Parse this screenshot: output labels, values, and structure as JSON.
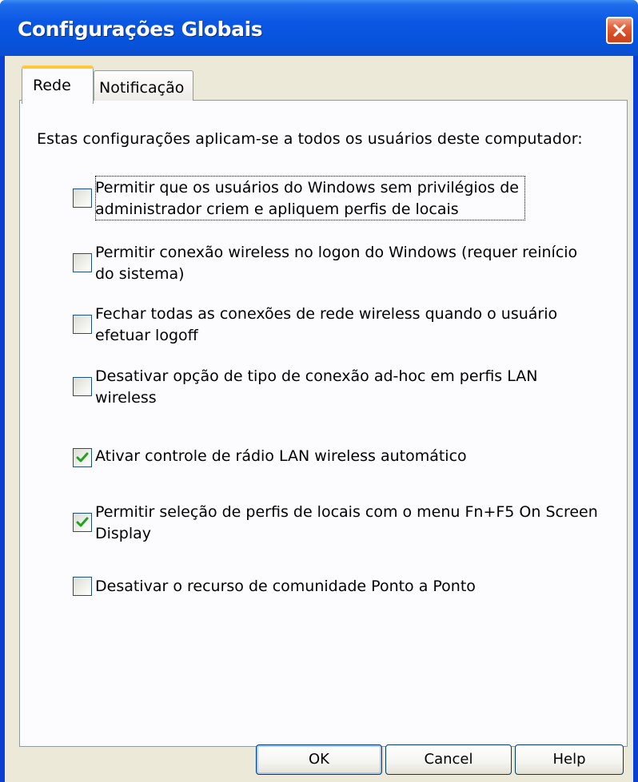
{
  "window": {
    "title": "Configurações Globais"
  },
  "tabs": [
    {
      "label": "Rede",
      "selected": true
    },
    {
      "label": "Notificação",
      "selected": false
    }
  ],
  "intro": "Estas configurações aplicam-se a todos os usuários deste computador:",
  "options": [
    {
      "label": "Permitir que os usuários do Windows sem privilégios de\nadministrador criem e apliquem perfis de locais",
      "checked": false
    },
    {
      "label": "Permitir conexão wireless no logon do Windows (requer reinício\ndo sistema)",
      "checked": false
    },
    {
      "label": "Fechar todas as conexões de rede wireless quando o usuário\nefetuar logoff",
      "checked": false
    },
    {
      "label": "Desativar opção de tipo de conexão ad-hoc em perfis LAN\nwireless",
      "checked": false
    },
    {
      "label": "Ativar controle de rádio LAN wireless automático",
      "checked": true
    },
    {
      "label": "Permitir seleção de perfis de locais com o menu Fn+F5 On Screen\nDisplay",
      "checked": true
    },
    {
      "label": "Desativar o recurso de comunidade Ponto a Ponto",
      "checked": false
    }
  ],
  "buttons": {
    "ok": "OK",
    "cancel": "Cancel",
    "help": "Help"
  },
  "colors": {
    "title_bar": "#0653dc",
    "dialog_face": "#ece9d8",
    "tab_accent": "#ffc83c",
    "close_button": "#d44a22",
    "check_mark": "#21a121"
  },
  "icons": {
    "close": "close-icon",
    "check": "checkmark-icon"
  }
}
